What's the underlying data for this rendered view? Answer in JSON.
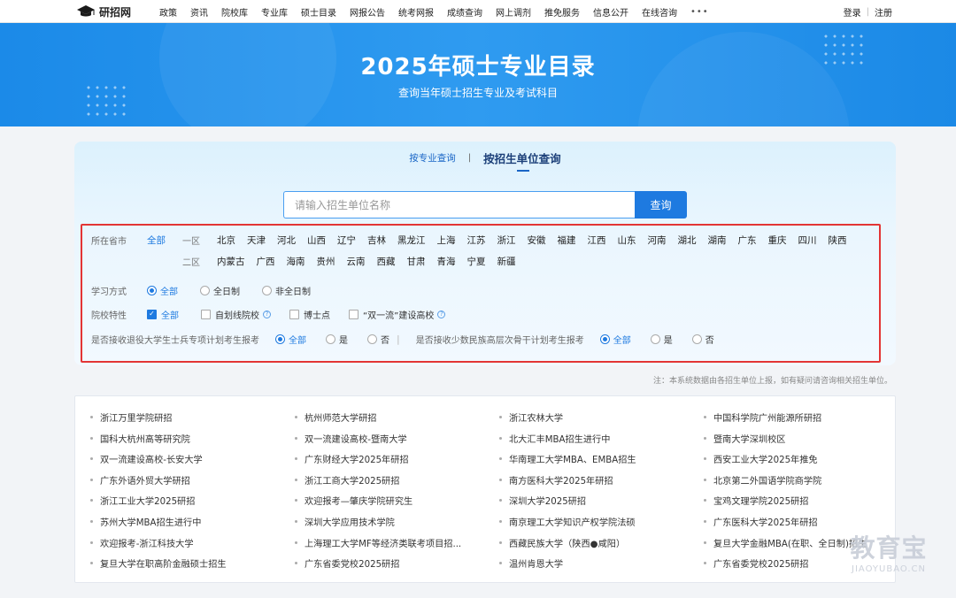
{
  "header": {
    "logo_text": "研招网",
    "logo_icon": "graduation-cap-icon",
    "nav": [
      "政策",
      "资讯",
      "院校库",
      "专业库",
      "硕士目录",
      "网报公告",
      "统考网报",
      "成绩查询",
      "网上调剂",
      "推免服务",
      "信息公开",
      "在线咨询"
    ],
    "more": "•••",
    "login": "登录",
    "separator": "|",
    "register": "注册"
  },
  "banner": {
    "title": "2025年硕士专业目录",
    "subtitle": "查询当年硕士招生专业及考试科目"
  },
  "tabs": {
    "by_major": "按专业查询",
    "separator": "|",
    "by_unit": "按招生单位查询",
    "active": "by_unit"
  },
  "search": {
    "placeholder": "请输入招生单位名称",
    "value": "",
    "button": "查询"
  },
  "filters": {
    "province_label": "所在省市",
    "all": "全部",
    "zone1_label": "一区",
    "zone1": [
      "北京",
      "天津",
      "河北",
      "山西",
      "辽宁",
      "吉林",
      "黑龙江",
      "上海",
      "江苏",
      "浙江",
      "安徽",
      "福建",
      "江西",
      "山东",
      "河南",
      "湖北",
      "湖南",
      "广东",
      "重庆",
      "四川",
      "陕西"
    ],
    "zone2_label": "二区",
    "zone2": [
      "内蒙古",
      "广西",
      "海南",
      "贵州",
      "云南",
      "西藏",
      "甘肃",
      "青海",
      "宁夏",
      "新疆"
    ],
    "study_mode": {
      "label": "学习方式",
      "options": [
        "全部",
        "全日制",
        "非全日制"
      ],
      "selected": 0
    },
    "school_type": {
      "label": "院校特性",
      "options": [
        "全部",
        "自划线院校",
        "博士点",
        "“双一流”建设高校"
      ],
      "checked": [
        true,
        false,
        false,
        false
      ]
    },
    "veteran": {
      "label": "是否接收退役大学生士兵专项计划考生报考",
      "options": [
        "全部",
        "是",
        "否"
      ],
      "selected": 0
    },
    "minority": {
      "label": "是否接收少数民族高层次骨干计划考生报考",
      "options": [
        "全部",
        "是",
        "否"
      ],
      "selected": 0
    }
  },
  "note": "注：本系统数据由各招生单位上报，如有疑问请咨询相关招生单位。",
  "links": [
    [
      "浙江万里学院研招",
      "杭州师范大学研招",
      "浙江农林大学",
      "中国科学院广州能源所研招"
    ],
    [
      "国科大杭州高等研究院",
      "双一流建设高校-暨南大学",
      "北大汇丰MBA招生进行中",
      "暨南大学深圳校区"
    ],
    [
      "双一流建设高校-长安大学",
      "广东财经大学2025年研招",
      "华南理工大学MBA、EMBA招生",
      "西安工业大学2025年推免"
    ],
    [
      "广东外语外贸大学研招",
      "浙江工商大学2025研招",
      "南方医科大学2025年研招",
      "北京第二外国语学院商学院"
    ],
    [
      "浙江工业大学2025研招",
      "欢迎报考—肇庆学院研究生",
      "深圳大学2025研招",
      "宝鸡文理学院2025研招"
    ],
    [
      "苏州大学MBA招生进行中",
      "深圳大学应用技术学院",
      "南京理工大学知识产权学院法硕",
      "广东医科大学2025年研招"
    ],
    [
      "欢迎报考-浙江科技大学",
      "上海理工大学MF等经济类联考项目招...",
      "西藏民族大学（陕西●咸阳）",
      "复旦大学金融MBA(在职、全日制)招生"
    ],
    [
      "复旦大学在职高阶金融硕士招生",
      "广东省委党校2025研招",
      "温州肯恩大学",
      "广东省委党校2025研招"
    ]
  ],
  "watermark": {
    "main": "教育宝",
    "domain": "JIAOYUBAO.CN"
  }
}
